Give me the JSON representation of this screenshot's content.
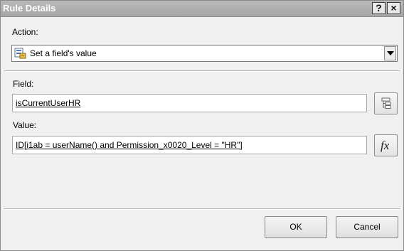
{
  "window": {
    "title": "Rule Details",
    "help_label": "?",
    "close_label": "×"
  },
  "action": {
    "label": "Action:",
    "selected": "Set a field's value",
    "icon": "set-field-value-icon"
  },
  "field": {
    "label": "Field:",
    "value": "isCurrentUserHR",
    "picker_icon": "field-tree-icon"
  },
  "value": {
    "label": "Value:",
    "value": "ID[i1ab = userName() and Permission_x0020_Level = \"HR\"]",
    "formula_label": "fx"
  },
  "buttons": {
    "ok": "OK",
    "cancel": "Cancel"
  }
}
